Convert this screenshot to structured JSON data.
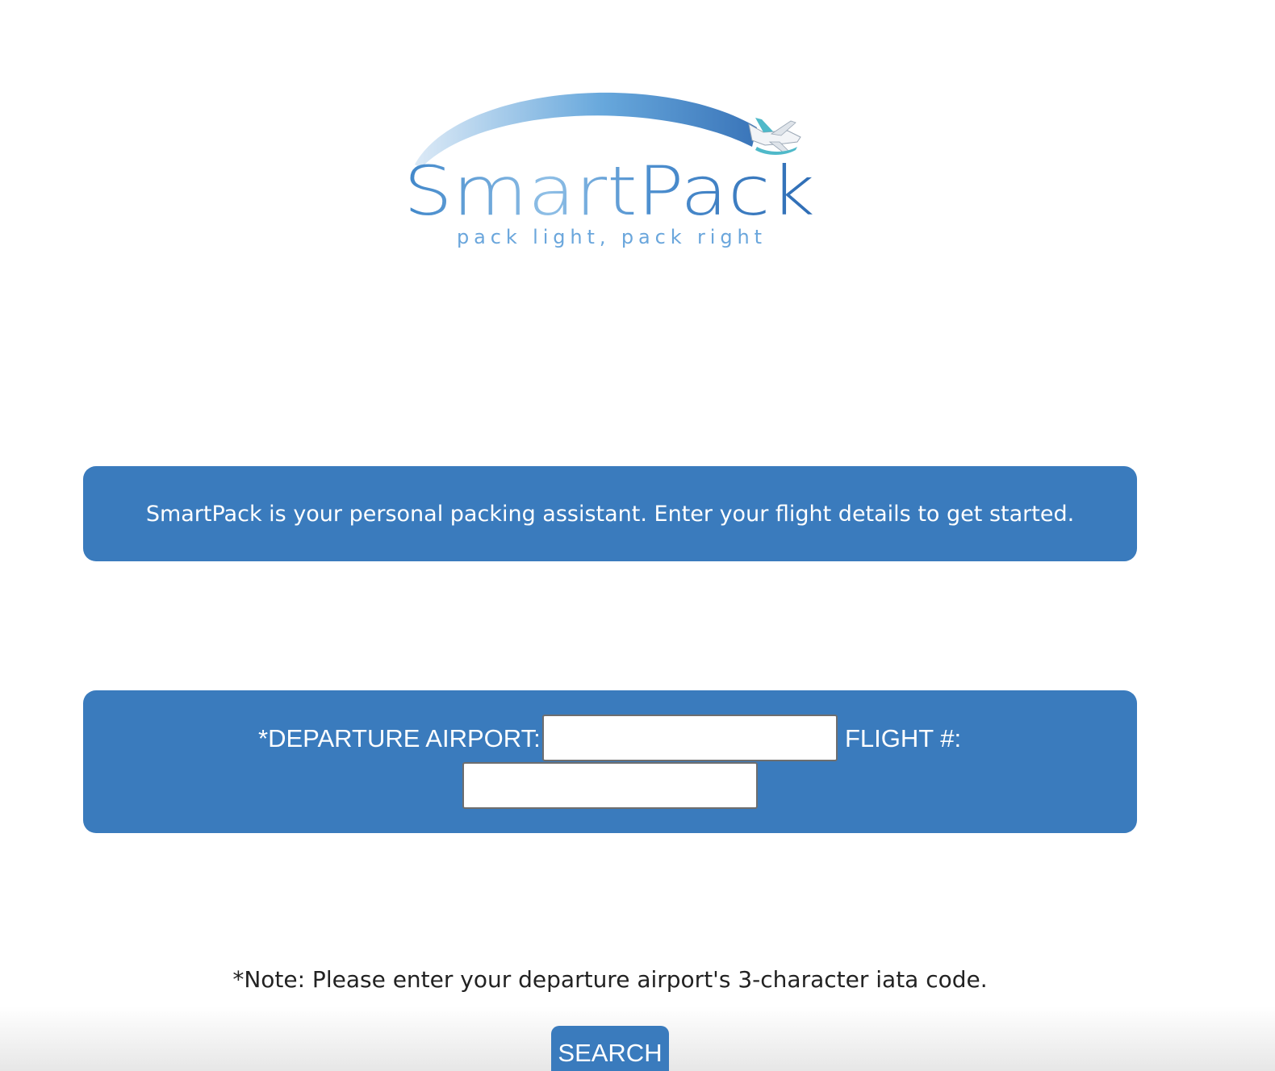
{
  "logo": {
    "name": "SmartPack",
    "tagline": "pack light, pack right",
    "icon": "airplane-icon",
    "colors": {
      "arc_start": "#d6e7f5",
      "arc_end": "#2f6db5",
      "text_dark": "#2f6db5",
      "text_light": "#7fb3e0",
      "tagline": "#6aa6dc",
      "accent": "#4fb9c9"
    }
  },
  "intro": {
    "text": "SmartPack is your personal packing assistant. Enter your flight details to get started."
  },
  "form": {
    "departure_label": "*DEPARTURE AIRPORT:",
    "departure_value": "",
    "flight_label": "FLIGHT #:",
    "flight_value": ""
  },
  "note": {
    "text": "*Note: Please enter your departure airport's 3-character iata code."
  },
  "search": {
    "label": "SEARCH"
  },
  "theme": {
    "panel_color": "#3a7bbd",
    "background": "#ffffff"
  }
}
